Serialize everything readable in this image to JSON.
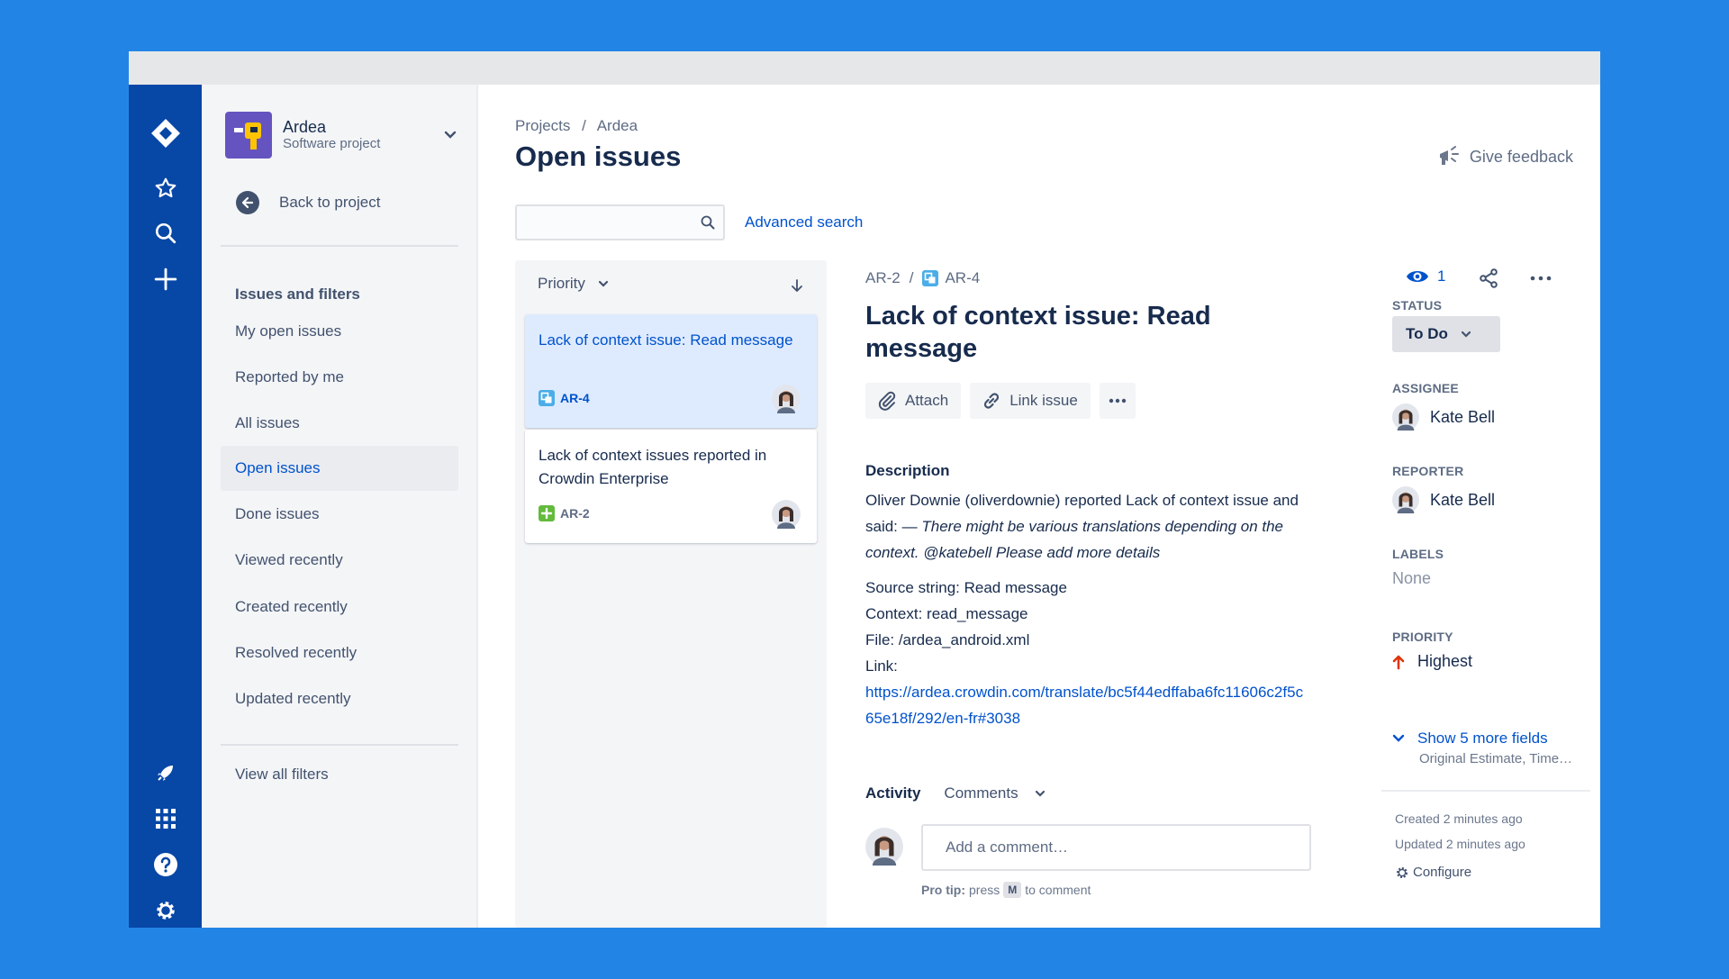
{
  "project": {
    "name": "Ardea",
    "type": "Software project"
  },
  "sidebar": {
    "back_label": "Back to project",
    "section_title": "Issues and filters",
    "items": [
      {
        "label": "My open issues",
        "active": false
      },
      {
        "label": "Reported by me",
        "active": false
      },
      {
        "label": "All issues",
        "active": false
      },
      {
        "label": "Open issues",
        "active": true
      },
      {
        "label": "Done issues",
        "active": false
      },
      {
        "label": "Viewed recently",
        "active": false
      },
      {
        "label": "Created recently",
        "active": false
      },
      {
        "label": "Resolved recently",
        "active": false
      },
      {
        "label": "Updated recently",
        "active": false
      }
    ],
    "view_all": "View all filters"
  },
  "header": {
    "breadcrumb": [
      "Projects",
      "/",
      "Ardea"
    ],
    "title": "Open issues",
    "feedback": "Give feedback"
  },
  "search": {
    "placeholder": "",
    "advanced_label": "Advanced search"
  },
  "list": {
    "sort_label": "Priority",
    "cards": [
      {
        "title": "Lack of context issue: Read message",
        "key": "AR-4",
        "type_icon": "task-icon",
        "selected": true
      },
      {
        "title": "Lack of context issues reported in Crowdin Enterprise",
        "key": "AR-2",
        "type_icon": "story-icon",
        "selected": false
      }
    ]
  },
  "issue": {
    "breadcrumb_parent": "AR-2",
    "breadcrumb_sep": "/",
    "key": "AR-4",
    "title": "Lack of context issue: Read message",
    "actions": {
      "attach": "Attach",
      "link": "Link issue"
    },
    "description_heading": "Description",
    "description_intro": "Oliver Downie (oliverdownie) reported Lack of context issue and said: —",
    "description_quote": "There might be various translations depending on the context. @katebell Please add more details",
    "source_string": "Source string: Read message",
    "context": "Context: read_message",
    "file": "File: /ardea_android.xml",
    "link_label": "Link:",
    "link_url": "https://ardea.crowdin.com/translate/bc5f44edffaba6fc11606c2f5c65e18f/292/en-fr#3038",
    "activity_heading": "Activity",
    "activity_filter": "Comments",
    "comment_placeholder": "Add a comment…",
    "protip_label": "Pro tip:",
    "protip_press": "press",
    "protip_key": "M",
    "protip_rest": "to comment"
  },
  "fields": {
    "watchers": "1",
    "status_label": "STATUS",
    "status": "To Do",
    "assignee_label": "ASSIGNEE",
    "assignee": "Kate Bell",
    "reporter_label": "REPORTER",
    "reporter": "Kate Bell",
    "labels_label": "LABELS",
    "labels": "None",
    "priority_label": "PRIORITY",
    "priority": "Highest",
    "more_fields": "Show 5 more fields",
    "more_fields_sub": "Original Estimate, Time…",
    "created": "Created 2 minutes ago",
    "updated": "Updated 2 minutes ago",
    "configure": "Configure"
  },
  "colors": {
    "accent": "#0052CC",
    "nav": "#0747A6",
    "background": "#2285E6",
    "priority_highest": "#DE350B"
  }
}
